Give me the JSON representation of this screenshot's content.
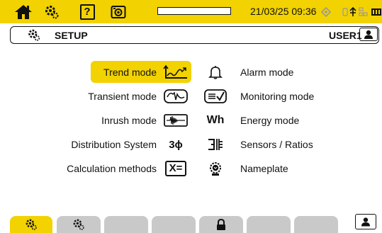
{
  "status_bar": {
    "datetime": "21/03/25 09:36",
    "help_label": "?",
    "icons": [
      "home-icon",
      "gear-icon",
      "help-icon",
      "camera-icon",
      "diamond-icon",
      "usb-network-icon",
      "battery-icon"
    ],
    "progress_fraction": 0.0
  },
  "header": {
    "title": "SETUP",
    "user": "USER1"
  },
  "menu": {
    "left": [
      {
        "label": "Trend mode",
        "icon": "trend-icon",
        "selected": true
      },
      {
        "label": "Transient mode",
        "icon": "transient-icon"
      },
      {
        "label": "Inrush mode",
        "icon": "inrush-icon"
      },
      {
        "label": "Distribution System",
        "icon": "three-phase-icon",
        "icon_text": "3ϕ"
      },
      {
        "label": "Calculation methods",
        "icon": "calculation-icon",
        "icon_text": "X="
      }
    ],
    "right": [
      {
        "label": "Alarm mode",
        "icon": "bell-icon"
      },
      {
        "label": "Monitoring mode",
        "icon": "monitoring-icon"
      },
      {
        "label": "Energy mode",
        "icon": "energy-icon",
        "icon_text": "Wh"
      },
      {
        "label": "Sensors / Ratios",
        "icon": "sensors-icon"
      },
      {
        "label": "Nameplate",
        "icon": "nameplate-icon"
      }
    ]
  },
  "colors": {
    "accent": "#f2d200",
    "tab_inactive": "#c9c9c9",
    "text": "#111111"
  },
  "tabs": [
    "gear-icon",
    "gear-icon",
    "",
    "",
    "lock-icon",
    "",
    "",
    "",
    "user-icon"
  ]
}
